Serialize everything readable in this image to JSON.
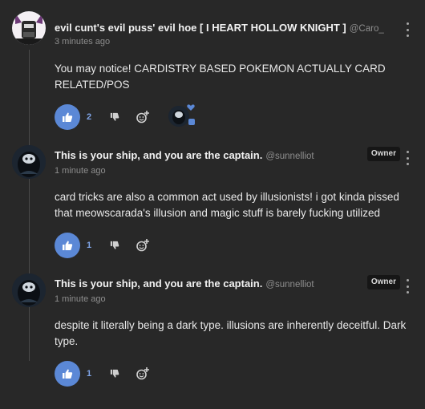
{
  "comments": [
    {
      "author": "evil cunt's evil puss' evil hoe [ I HEART HOLLOW KNIGHT ]",
      "handle": "@Caro_",
      "time": "3 minutes ago",
      "text": "You may notice! CARDISTRY BASED POKEMON ACTUALLY CARD RELATED/POS",
      "likes": "2",
      "badge": ""
    },
    {
      "author": "This is your ship, and you are the captain.",
      "handle": "@sunnelliot",
      "time": "1 minute ago",
      "text": "card tricks are also a common act used by illusionists! i got kinda pissed that meowscarada's illusion and magic stuff is barely fucking utilized",
      "likes": "1",
      "badge": "Owner"
    },
    {
      "author": "This is your ship, and you are the captain.",
      "handle": "@sunnelliot",
      "time": "1 minute ago",
      "text": "despite it literally being a dark type. illusions are inherently deceitful. Dark type.",
      "likes": "1",
      "badge": "Owner"
    }
  ],
  "colors": {
    "background": "#282828",
    "accent": "#5b88d6",
    "muted": "#8e8e8e"
  },
  "icons": {
    "like": "thumbs-up-icon",
    "dislike": "thumbs-down-icon",
    "react": "add-emoji-icon",
    "more": "vertical-dots-icon"
  }
}
